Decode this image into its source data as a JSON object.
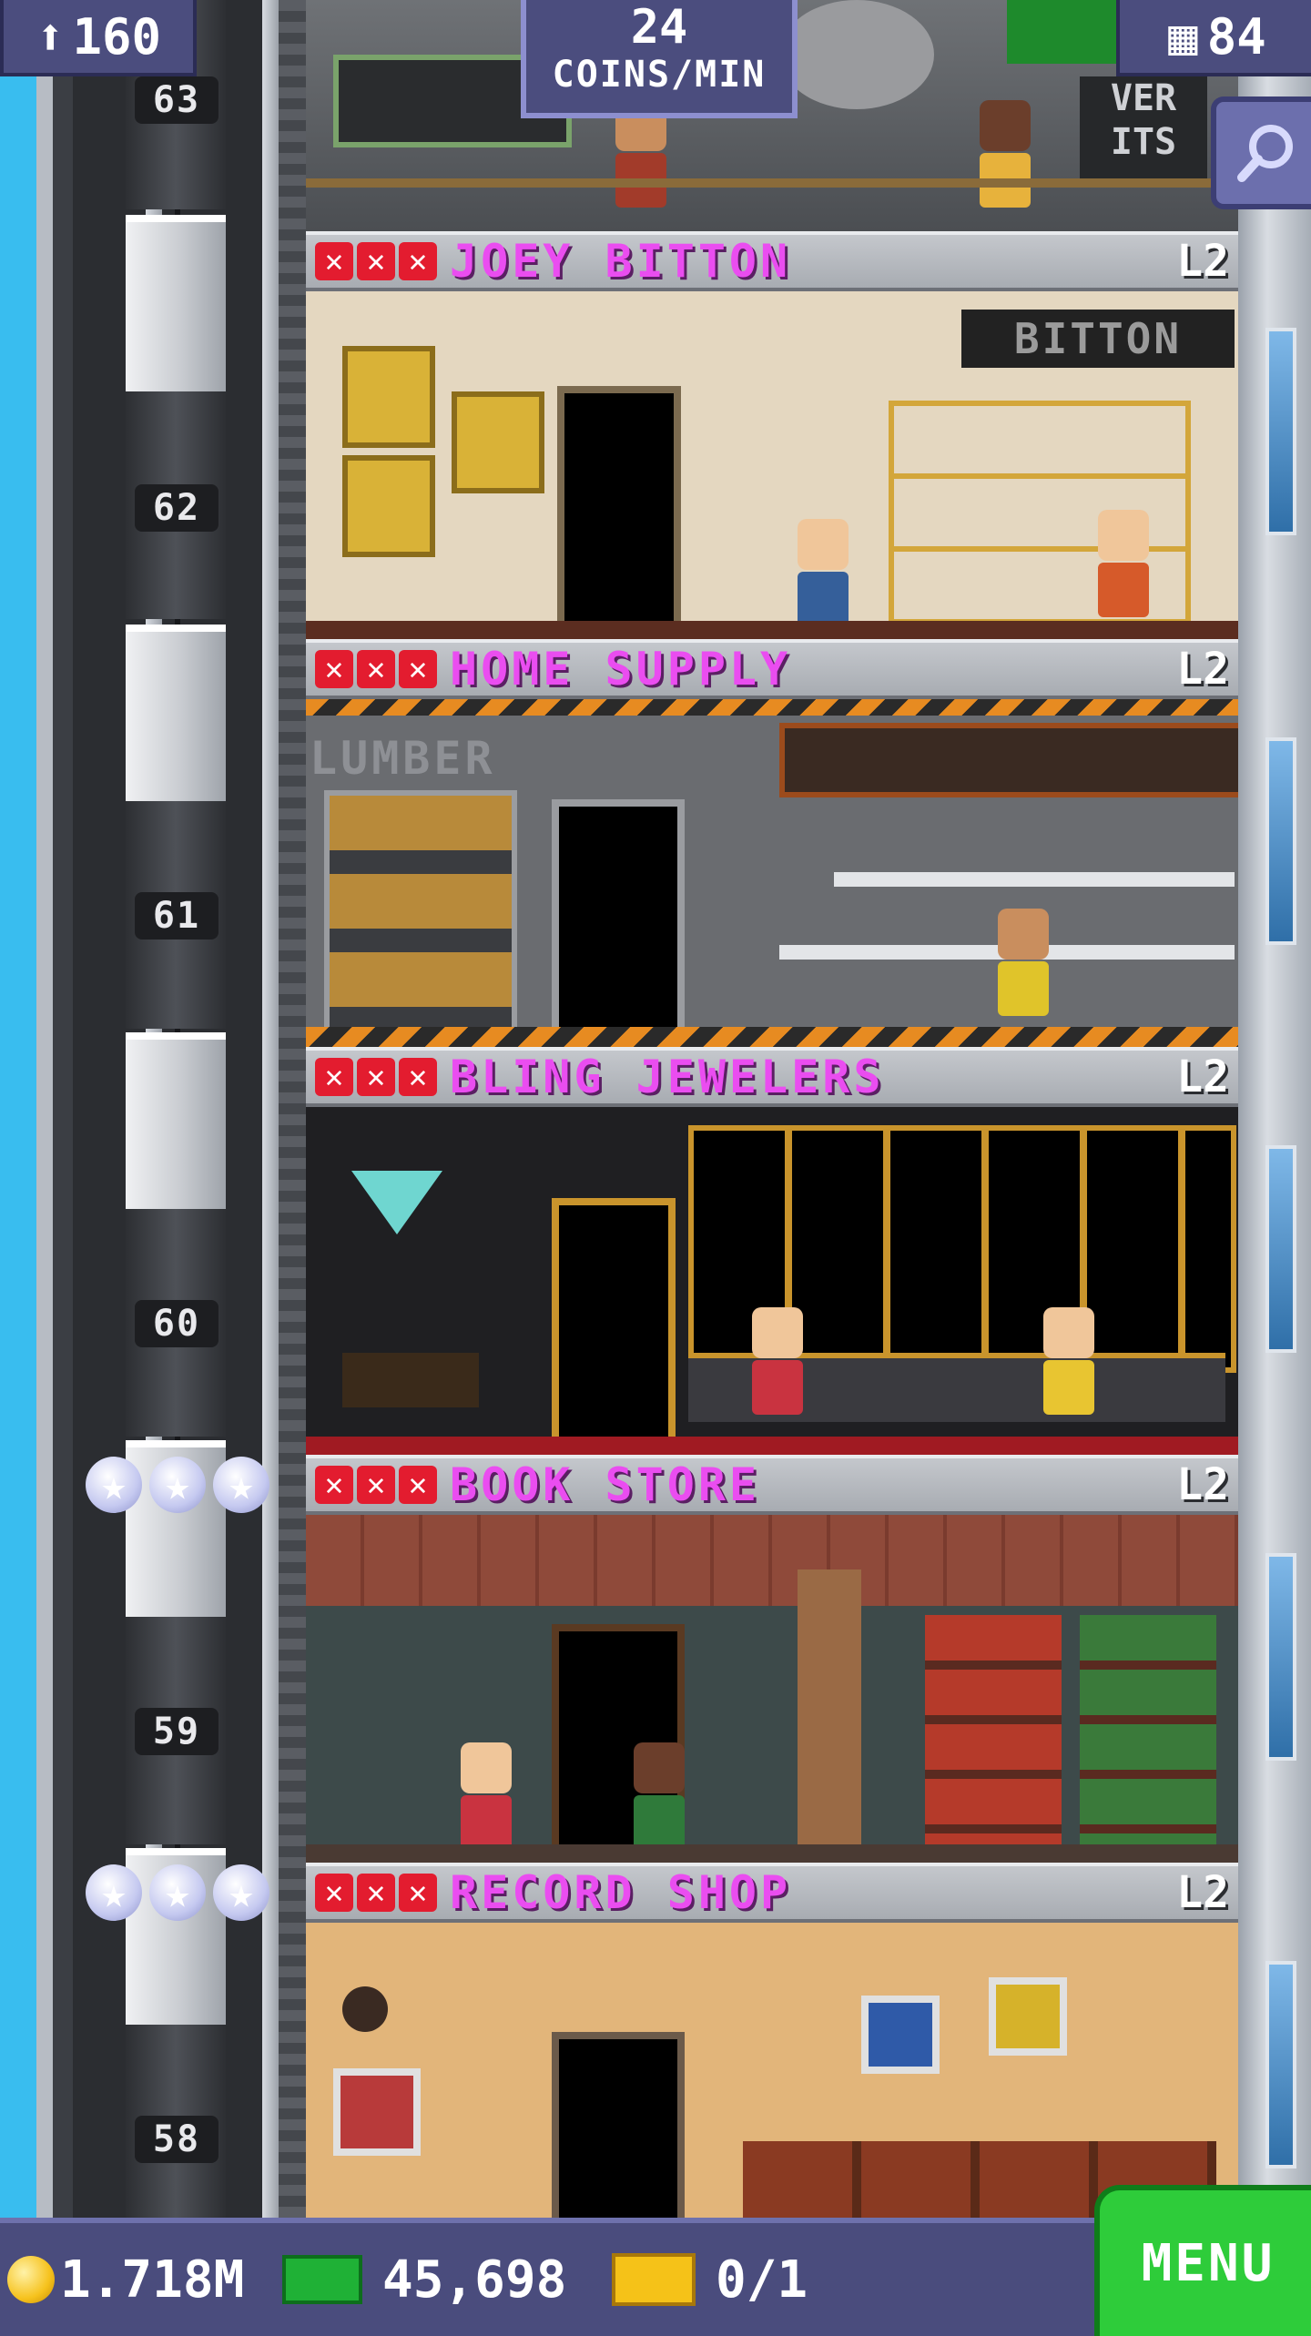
{
  "hud": {
    "population": "160",
    "coins_per_min_value": "24",
    "coins_per_min_unit": "COINS/MIN",
    "floor_count": "84",
    "icons": {
      "population": "person-icon",
      "floors": "building-icon",
      "search": "magnifier-icon"
    }
  },
  "top_floor_sign": "VER\nITS",
  "elevator": {
    "floor_numbers": [
      "63",
      "62",
      "61",
      "60",
      "59",
      "58"
    ]
  },
  "floors": [
    {
      "name": "JOEY BITTON",
      "level": "L2",
      "sign": "BITTON"
    },
    {
      "name": "HOME SUPPLY",
      "level": "L2",
      "sign": "LUMBER"
    },
    {
      "name": "BLING JEWELERS",
      "level": "L2",
      "sign": ""
    },
    {
      "name": "BOOK STORE",
      "level": "L2",
      "sign": ""
    },
    {
      "name": "RECORD SHOP",
      "level": "L2",
      "sign": ""
    }
  ],
  "bottom_bar": {
    "coins": "1.718M",
    "bux": "45,698",
    "tickets": "0/1",
    "menu_label": "MENU"
  },
  "colors": {
    "floor_name": "#ea4df0",
    "hud_bg": "#4b4d7e",
    "menu_bg": "#2ecc3a"
  }
}
